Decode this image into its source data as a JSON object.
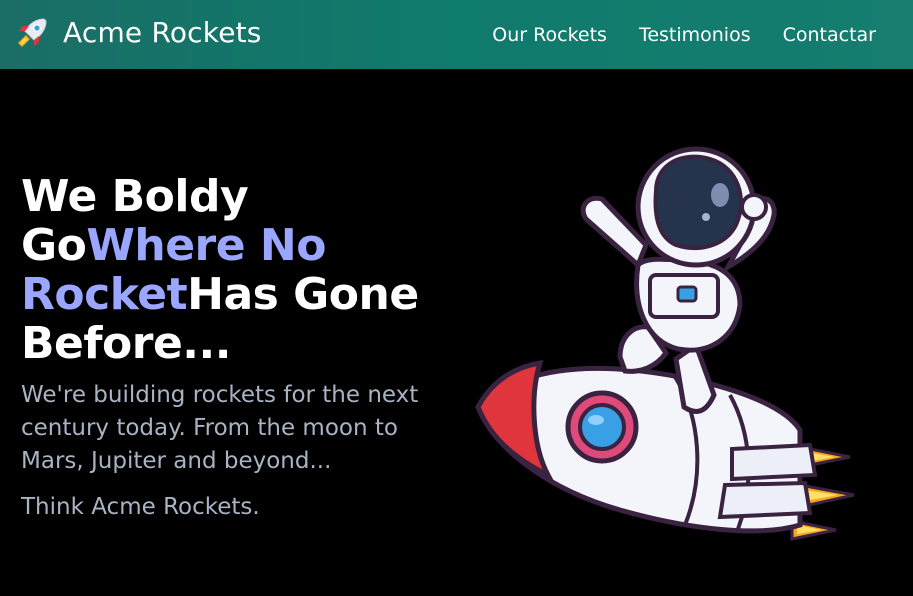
{
  "navbar": {
    "brand": {
      "name": "Acme Rockets",
      "icon": "rocket-icon"
    },
    "links": [
      {
        "label": "Our Rockets"
      },
      {
        "label": "Testimonios"
      },
      {
        "label": "Contactar"
      }
    ]
  },
  "hero": {
    "title": {
      "part1": "We Boldy Go",
      "accent1": "Where No Rocket",
      "part2": "Has Gone Before..."
    },
    "subtitle": "We're building rockets for the next century today. From the moon to Mars, Jupiter and beyond...",
    "tagline": "Think Acme Rockets.",
    "illustration": "astronaut-on-rocket-illustration"
  },
  "colors": {
    "navbar_bg": "#0f7b6c",
    "page_bg": "#000000",
    "accent": "#9aa6ff",
    "muted_text": "#a8b3c4"
  }
}
